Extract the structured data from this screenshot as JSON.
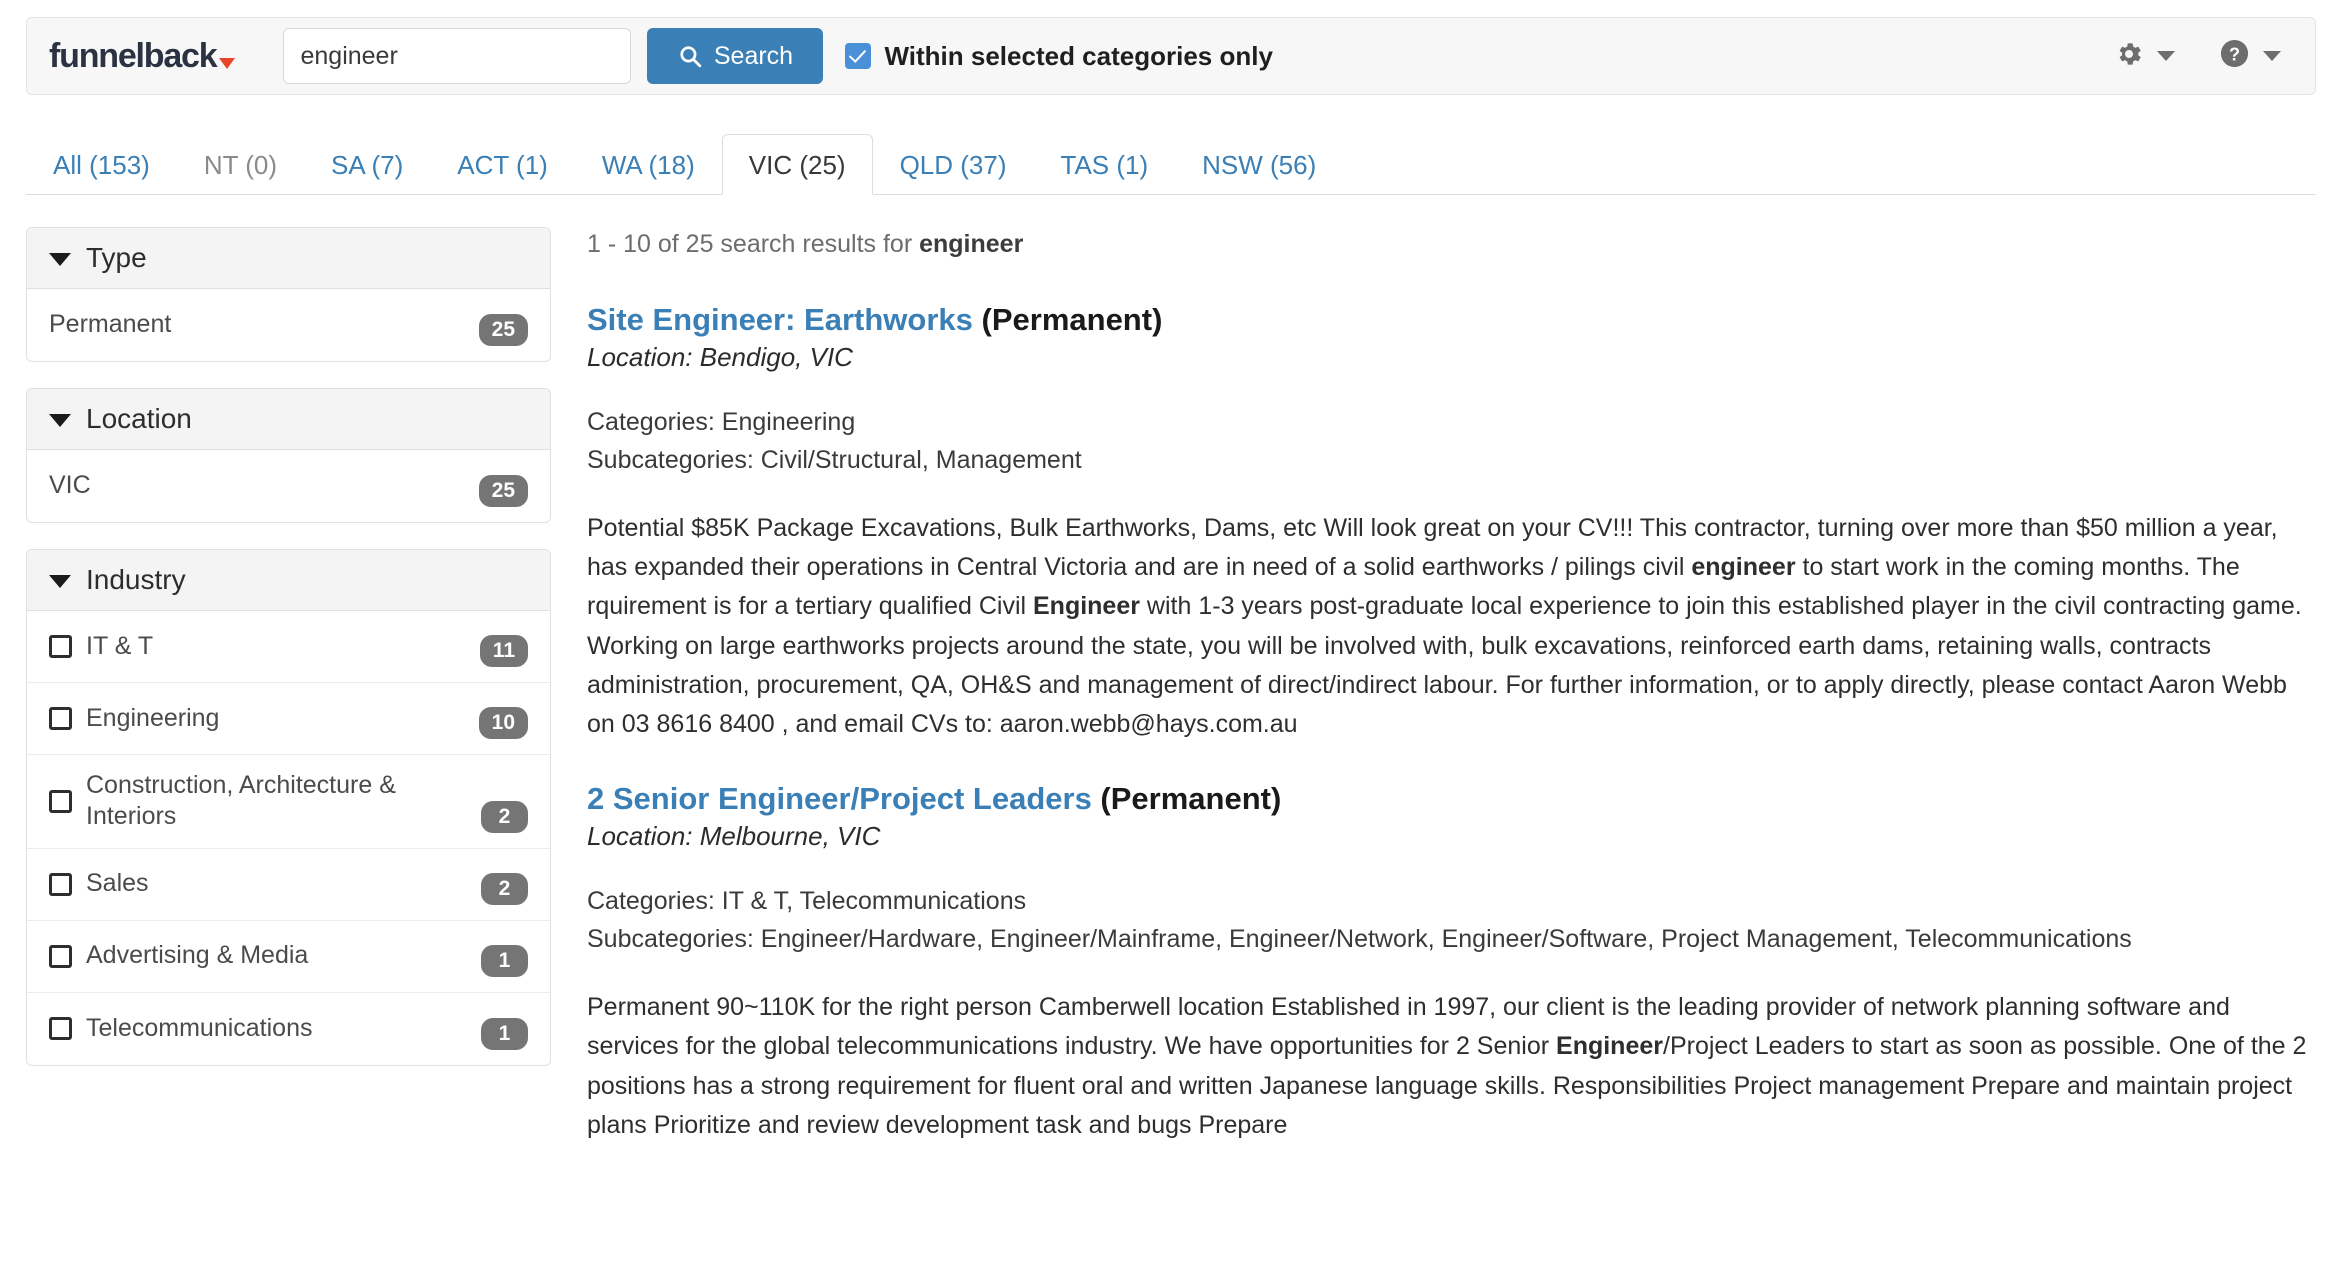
{
  "header": {
    "logo_text": "funnelback",
    "search": {
      "value": "engineer",
      "placeholder": "Search",
      "button_label": "Search",
      "icon": "search-icon"
    },
    "scope_checkbox": {
      "label": "Within selected categories only",
      "checked": true
    },
    "controls": [
      {
        "icon": "gear-icon",
        "caret": "chevron-down-icon"
      },
      {
        "icon": "help-circle-icon",
        "caret": "chevron-down-icon"
      }
    ]
  },
  "tabs": [
    {
      "label": "All (153)",
      "active": false,
      "disabled": false
    },
    {
      "label": "NT (0)",
      "active": false,
      "disabled": true
    },
    {
      "label": "SA (7)",
      "active": false,
      "disabled": false
    },
    {
      "label": "ACT (1)",
      "active": false,
      "disabled": false
    },
    {
      "label": "WA (18)",
      "active": false,
      "disabled": false
    },
    {
      "label": "VIC (25)",
      "active": true,
      "disabled": false
    },
    {
      "label": "QLD (37)",
      "active": false,
      "disabled": false
    },
    {
      "label": "TAS (1)",
      "active": false,
      "disabled": false
    },
    {
      "label": "NSW (56)",
      "active": false,
      "disabled": false
    }
  ],
  "sidebar": {
    "facets": [
      {
        "title": "Type",
        "icon": "chevron-down-icon",
        "checkboxes": false,
        "items": [
          {
            "label": "Permanent",
            "count": "25"
          }
        ]
      },
      {
        "title": "Location",
        "icon": "chevron-down-icon",
        "checkboxes": false,
        "items": [
          {
            "label": "VIC",
            "count": "25"
          }
        ]
      },
      {
        "title": "Industry",
        "icon": "chevron-down-icon",
        "checkboxes": true,
        "items": [
          {
            "label": "IT & T",
            "count": "11"
          },
          {
            "label": "Engineering",
            "count": "10"
          },
          {
            "label": "Construction, Architecture & Interiors",
            "count": "2"
          },
          {
            "label": "Sales",
            "count": "2"
          },
          {
            "label": "Advertising & Media",
            "count": "1"
          },
          {
            "label": "Telecommunications",
            "count": "1"
          }
        ]
      }
    ]
  },
  "main": {
    "summary_prefix": "1 - 10 of 25 search results for ",
    "summary_query": "engineer",
    "results": [
      {
        "title_plain_1": "Site ",
        "title_highlight": "Engineer",
        "title_plain_2": ": Earthworks",
        "type": " (Permanent)",
        "location": "Location: Bendigo, VIC",
        "categories": "Categories: Engineering",
        "subcategories": "Subcategories: Civil/Structural, Management",
        "description_parts": [
          {
            "text": "Potential $85K Package Excavations, Bulk Earthworks, Dams, etc Will look great on your CV!!! This contractor, turning over more than $50 million a year, has expanded their operations in Central Victoria and are in need of a solid earthworks / pilings civil ",
            "bold": false
          },
          {
            "text": "engineer",
            "bold": true
          },
          {
            "text": " to start work in the coming months. The rquirement is for a tertiary qualified Civil ",
            "bold": false
          },
          {
            "text": "Engineer",
            "bold": true
          },
          {
            "text": " with 1-3 years post-graduate local experience to join this established player in the civil contracting game. Working on large earthworks projects around the state, you will be involved with, bulk excavations, reinforced earth dams, retaining walls, contracts administration, procurement, QA, OH&S and management of direct/indirect labour. For further information, or to apply directly, please contact Aaron Webb on 03 8616 8400 , and email CVs to: aaron.webb@hays.com.au",
            "bold": false
          }
        ]
      },
      {
        "title_plain_1": "2 Senior ",
        "title_highlight": "Engineer",
        "title_plain_2": "/Project Leaders",
        "type": " (Permanent)",
        "location": "Location: Melbourne, VIC",
        "categories": "Categories: IT & T, Telecommunications",
        "subcategories": "Subcategories: Engineer/Hardware, Engineer/Mainframe, Engineer/Network, Engineer/Software, Project Management, Telecommunications",
        "description_parts": [
          {
            "text": "Permanent 90~110K for the right person Camberwell location Established in 1997, our client is the leading provider of network planning software and services for the global telecommunications industry. We have opportunities for 2 Senior ",
            "bold": false
          },
          {
            "text": "Engineer",
            "bold": true
          },
          {
            "text": "/Project Leaders to start as soon as possible. One of the 2 positions has a strong requirement for fluent oral and written Japanese language skills. Responsibilities Project management Prepare and maintain project plans Prioritize and review development task and bugs Prepare",
            "bold": false
          }
        ]
      }
    ]
  },
  "colors": {
    "accent_blue": "#3a7fb5",
    "checkbox_blue": "#4a90d9",
    "logo_navy": "#2b3342",
    "logo_red": "#e8452c",
    "badge_gray": "#757575",
    "header_bg": "#f7f7f7"
  }
}
